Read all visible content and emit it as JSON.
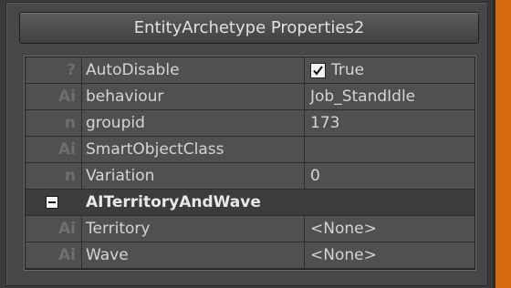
{
  "window": {
    "title": "EntityArchetype Properties2"
  },
  "properties": [
    {
      "type_icon": "?",
      "name": "AutoDisable",
      "value": "True",
      "checkbox": true
    },
    {
      "type_icon": "Ai",
      "name": "behaviour",
      "value": "Job_StandIdle"
    },
    {
      "type_icon": "n",
      "name": "groupid",
      "value": "173"
    },
    {
      "type_icon": "Ai",
      "name": "SmartObjectClass",
      "value": ""
    },
    {
      "type_icon": "n",
      "name": "Variation",
      "value": "0"
    }
  ],
  "section": {
    "label": "AITerritoryAndWave",
    "collapsed": false
  },
  "section_properties": [
    {
      "type_icon": "Ai",
      "name": "Territory",
      "value": "<None>"
    },
    {
      "type_icon": "Ai",
      "name": "Wave",
      "value": "<None>"
    }
  ],
  "colors": {
    "accent_strip": "#d86a10",
    "panel_bg": "#505050",
    "section_bg": "#3c3c3c"
  }
}
